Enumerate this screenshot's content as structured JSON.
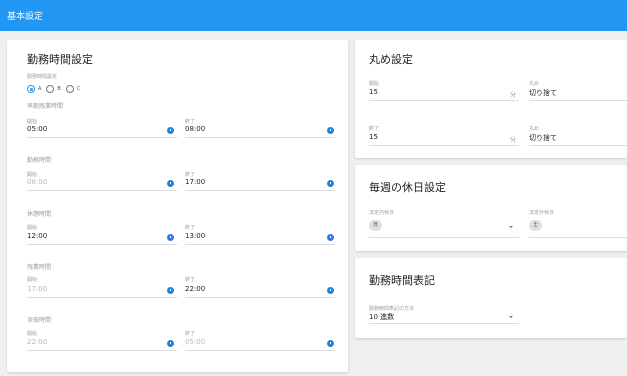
{
  "appbar": {
    "title": "基本設定"
  },
  "work": {
    "title": "勤務時間設定",
    "pattern_label": "勤務時間設定",
    "options": [
      "A",
      "B",
      "C"
    ],
    "early": {
      "label": "早朝残業時間",
      "start_label": "開始",
      "start": "05:00",
      "end_label": "終了",
      "end": "08:00"
    },
    "regular": {
      "label": "勤務時間",
      "start_label": "開始",
      "start": "08:00",
      "end_label": "終了",
      "end": "17:00"
    },
    "break": {
      "label": "休憩時間",
      "start_label": "開始",
      "start": "12:00",
      "end_label": "終了",
      "end": "13:00"
    },
    "overtime": {
      "label": "残業時間",
      "start_label": "開始",
      "start": "17:00",
      "end_label": "終了",
      "end": "22:00"
    },
    "night": {
      "label": "深夜時間",
      "start_label": "開始",
      "start": "22:00",
      "end_label": "終了",
      "end": "05:00"
    }
  },
  "rounding": {
    "title": "丸め設定",
    "start": {
      "label": "開始",
      "value": "15",
      "unit": "分",
      "mode_label": "丸め",
      "mode": "切り捨て"
    },
    "end": {
      "label": "終了",
      "value": "15",
      "unit": "分",
      "mode_label": "丸め",
      "mode": "切り捨て"
    }
  },
  "holiday": {
    "title": "毎週の休日設定",
    "legal_label": "法定内休日",
    "legal_value": "日",
    "extra_label": "法定外休日",
    "extra_value": "土"
  },
  "display": {
    "title": "勤務時間表記",
    "method_label": "勤務時間表記の方法",
    "method_value": "10 進数"
  }
}
